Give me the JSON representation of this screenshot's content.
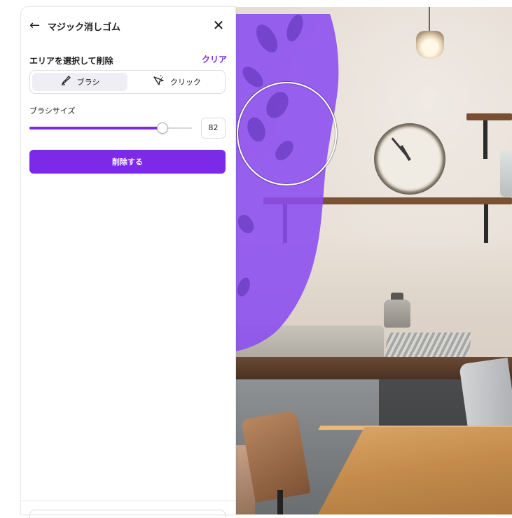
{
  "panel": {
    "title": "マジック消しゴム",
    "section_label": "エリアを選択して削除",
    "clear_label": "クリア",
    "modes": [
      {
        "label": "ブラシ",
        "icon": "brush-icon",
        "active": true
      },
      {
        "label": "クリック",
        "icon": "click-cursor-icon",
        "active": false
      }
    ],
    "brush_size_label": "ブラシサイズ",
    "brush_size_value": "82",
    "brush_size_fraction": 0.82,
    "erase_button_label": "削除する"
  },
  "colors": {
    "accent": "#7d2ae8",
    "mask": "#8b4cf0"
  }
}
